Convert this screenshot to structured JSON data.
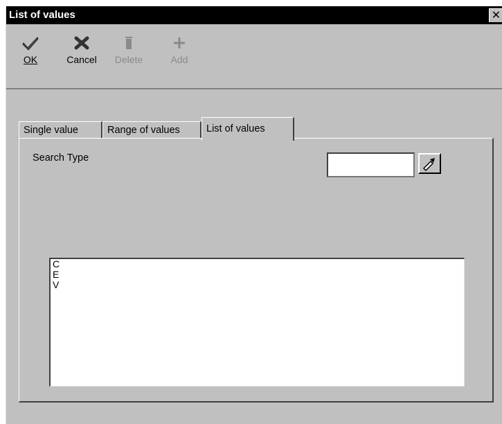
{
  "window": {
    "title": "List of values",
    "close_glyph": "✕"
  },
  "toolbar": {
    "ok_label": "OK",
    "cancel_label": "Cancel",
    "delete_label": "Delete",
    "add_label": "Add",
    "icons": [
      "check-icon",
      "x-icon",
      "trash-icon",
      "plus-icon"
    ]
  },
  "tabs": [
    {
      "label": "Single value",
      "active": false
    },
    {
      "label": "Range of values",
      "active": false
    },
    {
      "label": "List of values",
      "active": true
    }
  ],
  "search": {
    "label": "Search Type",
    "value": ""
  },
  "list": {
    "items": [
      "C",
      "E",
      "V"
    ]
  }
}
